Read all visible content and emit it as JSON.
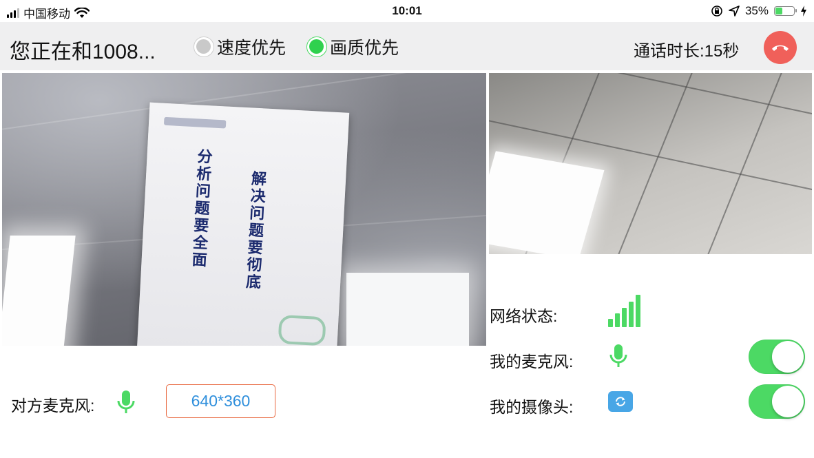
{
  "status_bar": {
    "carrier": "中国移动",
    "time": "10:01",
    "battery_percent": "35%",
    "battery_level": 0.35,
    "icons": [
      "signal-icon",
      "wifi-icon",
      "orientation-lock-icon",
      "location-icon",
      "battery-icon",
      "charging-icon"
    ]
  },
  "header": {
    "call_title": "您正在和1008...",
    "quality_options": [
      {
        "label": "速度优先",
        "selected": false
      },
      {
        "label": "画质优先",
        "selected": true
      }
    ],
    "duration": "通话时长:15秒",
    "hangup_icon": "hangup-phone-icon"
  },
  "remote_video": {
    "poster_lines": [
      "分析问题要全面",
      "解决问题要彻底"
    ]
  },
  "peer": {
    "mic_label": "对方麦克风:",
    "mic_icon": "microphone-icon",
    "resolution": "640*360"
  },
  "self_panel": {
    "network_label": "网络状态:",
    "network_icon": "signal-strength-icon",
    "network_bars": 5,
    "mic_label": "我的麦克风:",
    "mic_icon": "microphone-icon",
    "mic_enabled": true,
    "camera_label": "我的摄像头:",
    "camera_icon": "switch-camera-icon",
    "camera_enabled": true
  },
  "colors": {
    "accent_green": "#4cd964",
    "hangup_red": "#f0605a",
    "resolution_border": "#e8663d",
    "resolution_text": "#2f8fdc",
    "header_bg": "#efeff0"
  }
}
